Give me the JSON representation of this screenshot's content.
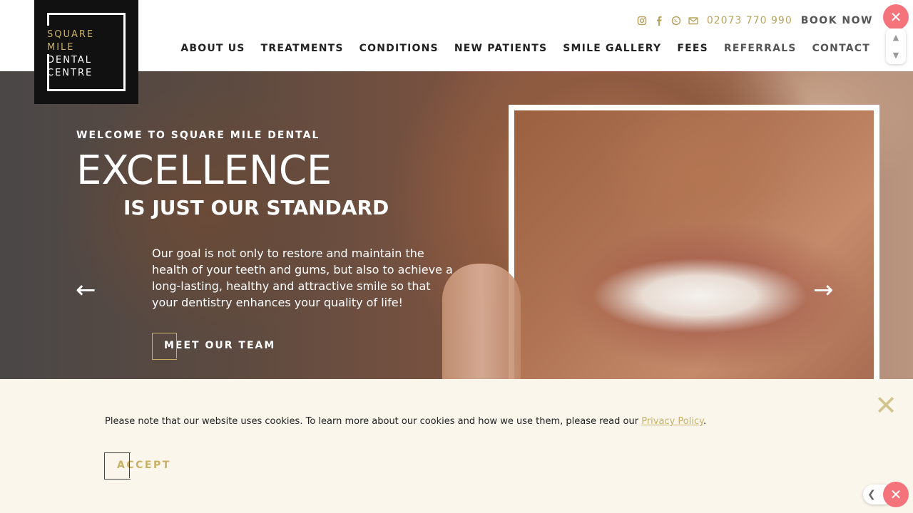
{
  "brand": {
    "logo_lines_gold": [
      "SQUARE",
      "MILE"
    ],
    "logo_lines_white": [
      "DENTAL",
      "CENTRE"
    ],
    "gold": "#c9b065"
  },
  "topbar": {
    "icons": [
      "instagram-icon",
      "facebook-icon",
      "whatsapp-icon",
      "email-icon"
    ],
    "phone": "02073 770 990",
    "book": "BOOK NOW"
  },
  "nav": {
    "items": [
      "ABOUT US",
      "TREATMENTS",
      "CONDITIONS",
      "NEW PATIENTS",
      "SMILE GALLERY",
      "FEES",
      "REFERRALS",
      "CONTACT"
    ]
  },
  "hero": {
    "welcome": "WELCOME TO SQUARE MILE DENTAL",
    "headline": "EXCELLENCE",
    "subheadline": "IS JUST OUR STANDARD",
    "copy": "Our goal is not only to restore and maintain the health of your teeth and gums, but also to achieve a long-lasting, healthy and attractive smile so that your dentistry enhances your quality of life!",
    "cta": "MEET OUR TEAM",
    "prev": "←",
    "next": "→"
  },
  "cookie": {
    "text": "Please note that our website uses cookies. To learn more about our cookies and how we use them, please read our ",
    "link": "Privacy Policy",
    "period": ".",
    "accept": "ACCEPT",
    "close": "✕"
  },
  "widgets": {
    "close": "✕",
    "up": "▲",
    "down": "▼",
    "chevron": "❮"
  }
}
